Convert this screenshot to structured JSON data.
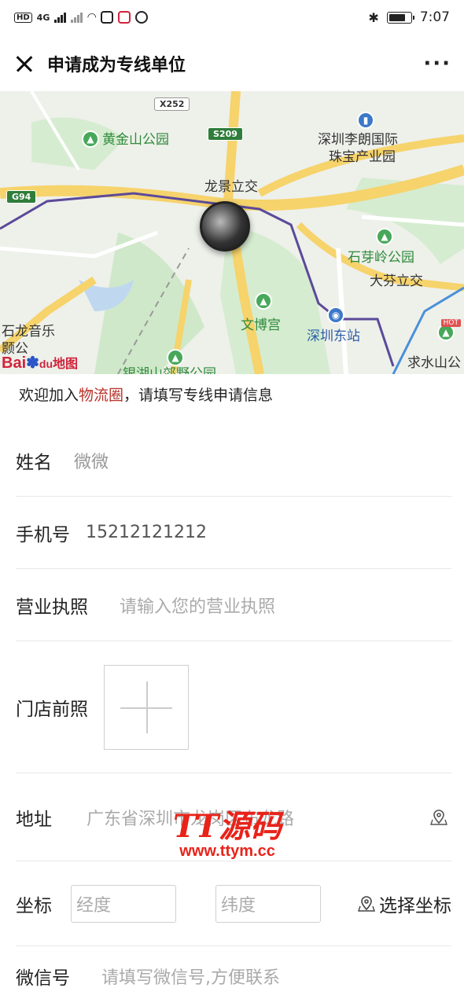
{
  "status_bar": {
    "network": "4G",
    "time": "7:07"
  },
  "nav": {
    "title": "申请成为专线单位",
    "more": "···"
  },
  "map": {
    "labels": {
      "huangjinshan": "黄金山公园",
      "lilang": "深圳李朗国际",
      "lilang2": "珠宝产业园",
      "longjing": "龙景立交",
      "shiyaling": "石芽岭公园",
      "dafen": "大芬立交",
      "wenbo": "文博宫",
      "shenzhen_east": "深圳东站",
      "shilong": "石龙音乐",
      "shilong2": "颢公",
      "qiushui": "求水山公",
      "yinhu": "银湖山郊野公园"
    },
    "signs": {
      "x252": "X252",
      "s209": "S209",
      "g94": "G94"
    },
    "baidu": "Bai",
    "baidu_du": "du",
    "baidu_map": "地图",
    "hot": "HOT"
  },
  "intro": {
    "prefix": "欢迎加入",
    "highlight": "物流圈",
    "suffix": "，请填写专线申请信息"
  },
  "form": {
    "name_label": "姓名",
    "name_value": "微微",
    "phone_label": "手机号",
    "phone_value": "15212121212",
    "license_label": "营业执照",
    "license_placeholder": "请输入您的营业执照",
    "store_photo_label": "门店前照",
    "address_label": "地址",
    "address_value": "广东省深圳市龙岗区布龙路",
    "coord_label": "坐标",
    "longitude_placeholder": "经度",
    "latitude_placeholder": "纬度",
    "choose_coord": "选择坐标",
    "wechat_label": "微信号",
    "wechat_placeholder": "请填写微信号,方便联系"
  },
  "watermark": {
    "big": "TT源码",
    "small": "www.ttym.cc"
  },
  "colors": {
    "highlight": "#b8322a",
    "route": "#5b4a9a",
    "road_yellow": "#f6d36b"
  }
}
